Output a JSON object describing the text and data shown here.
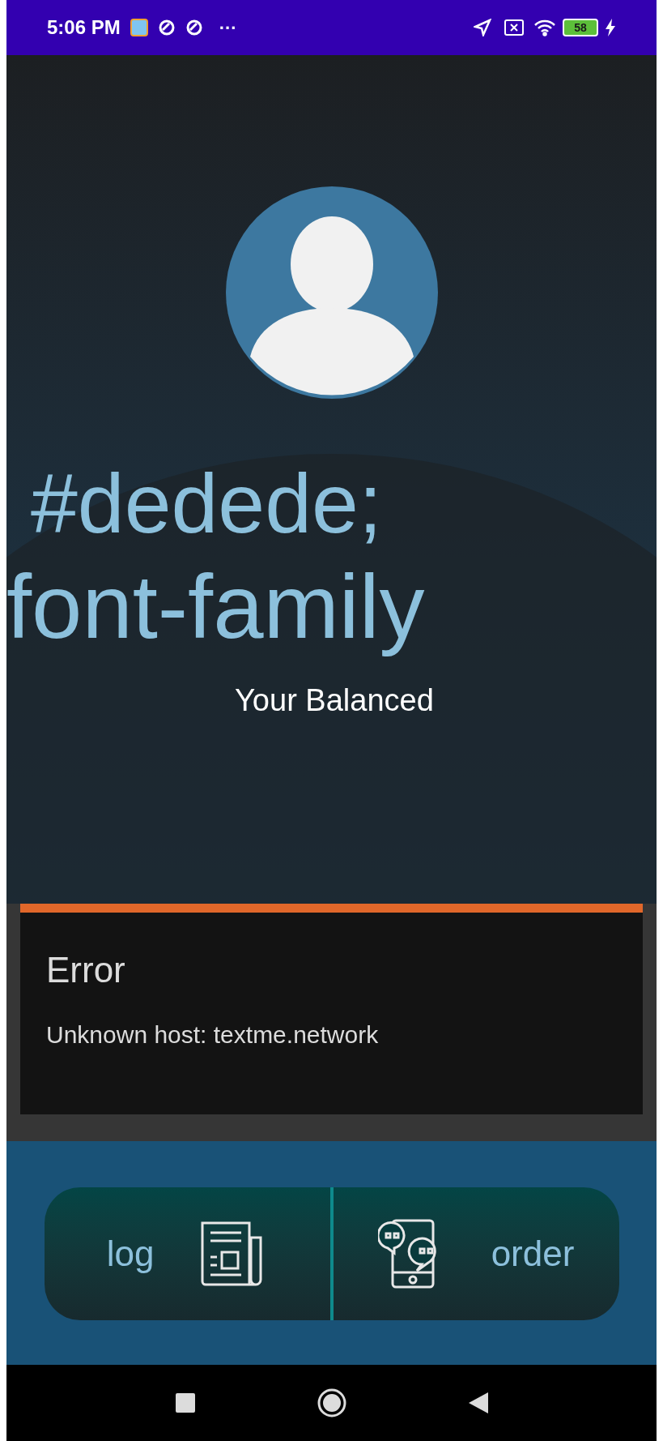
{
  "status_bar": {
    "time": "5:06 PM",
    "more": "···",
    "battery": "58"
  },
  "profile": {
    "line_1": "#dedede;",
    "line_2": "font-family",
    "balance_label": "Your Balanced"
  },
  "error_dialog": {
    "title": "Error",
    "message": "Unknown host: textme.network"
  },
  "actions": [
    {
      "kind": "log",
      "label": "log"
    },
    {
      "kind": "order",
      "label": "order"
    }
  ]
}
